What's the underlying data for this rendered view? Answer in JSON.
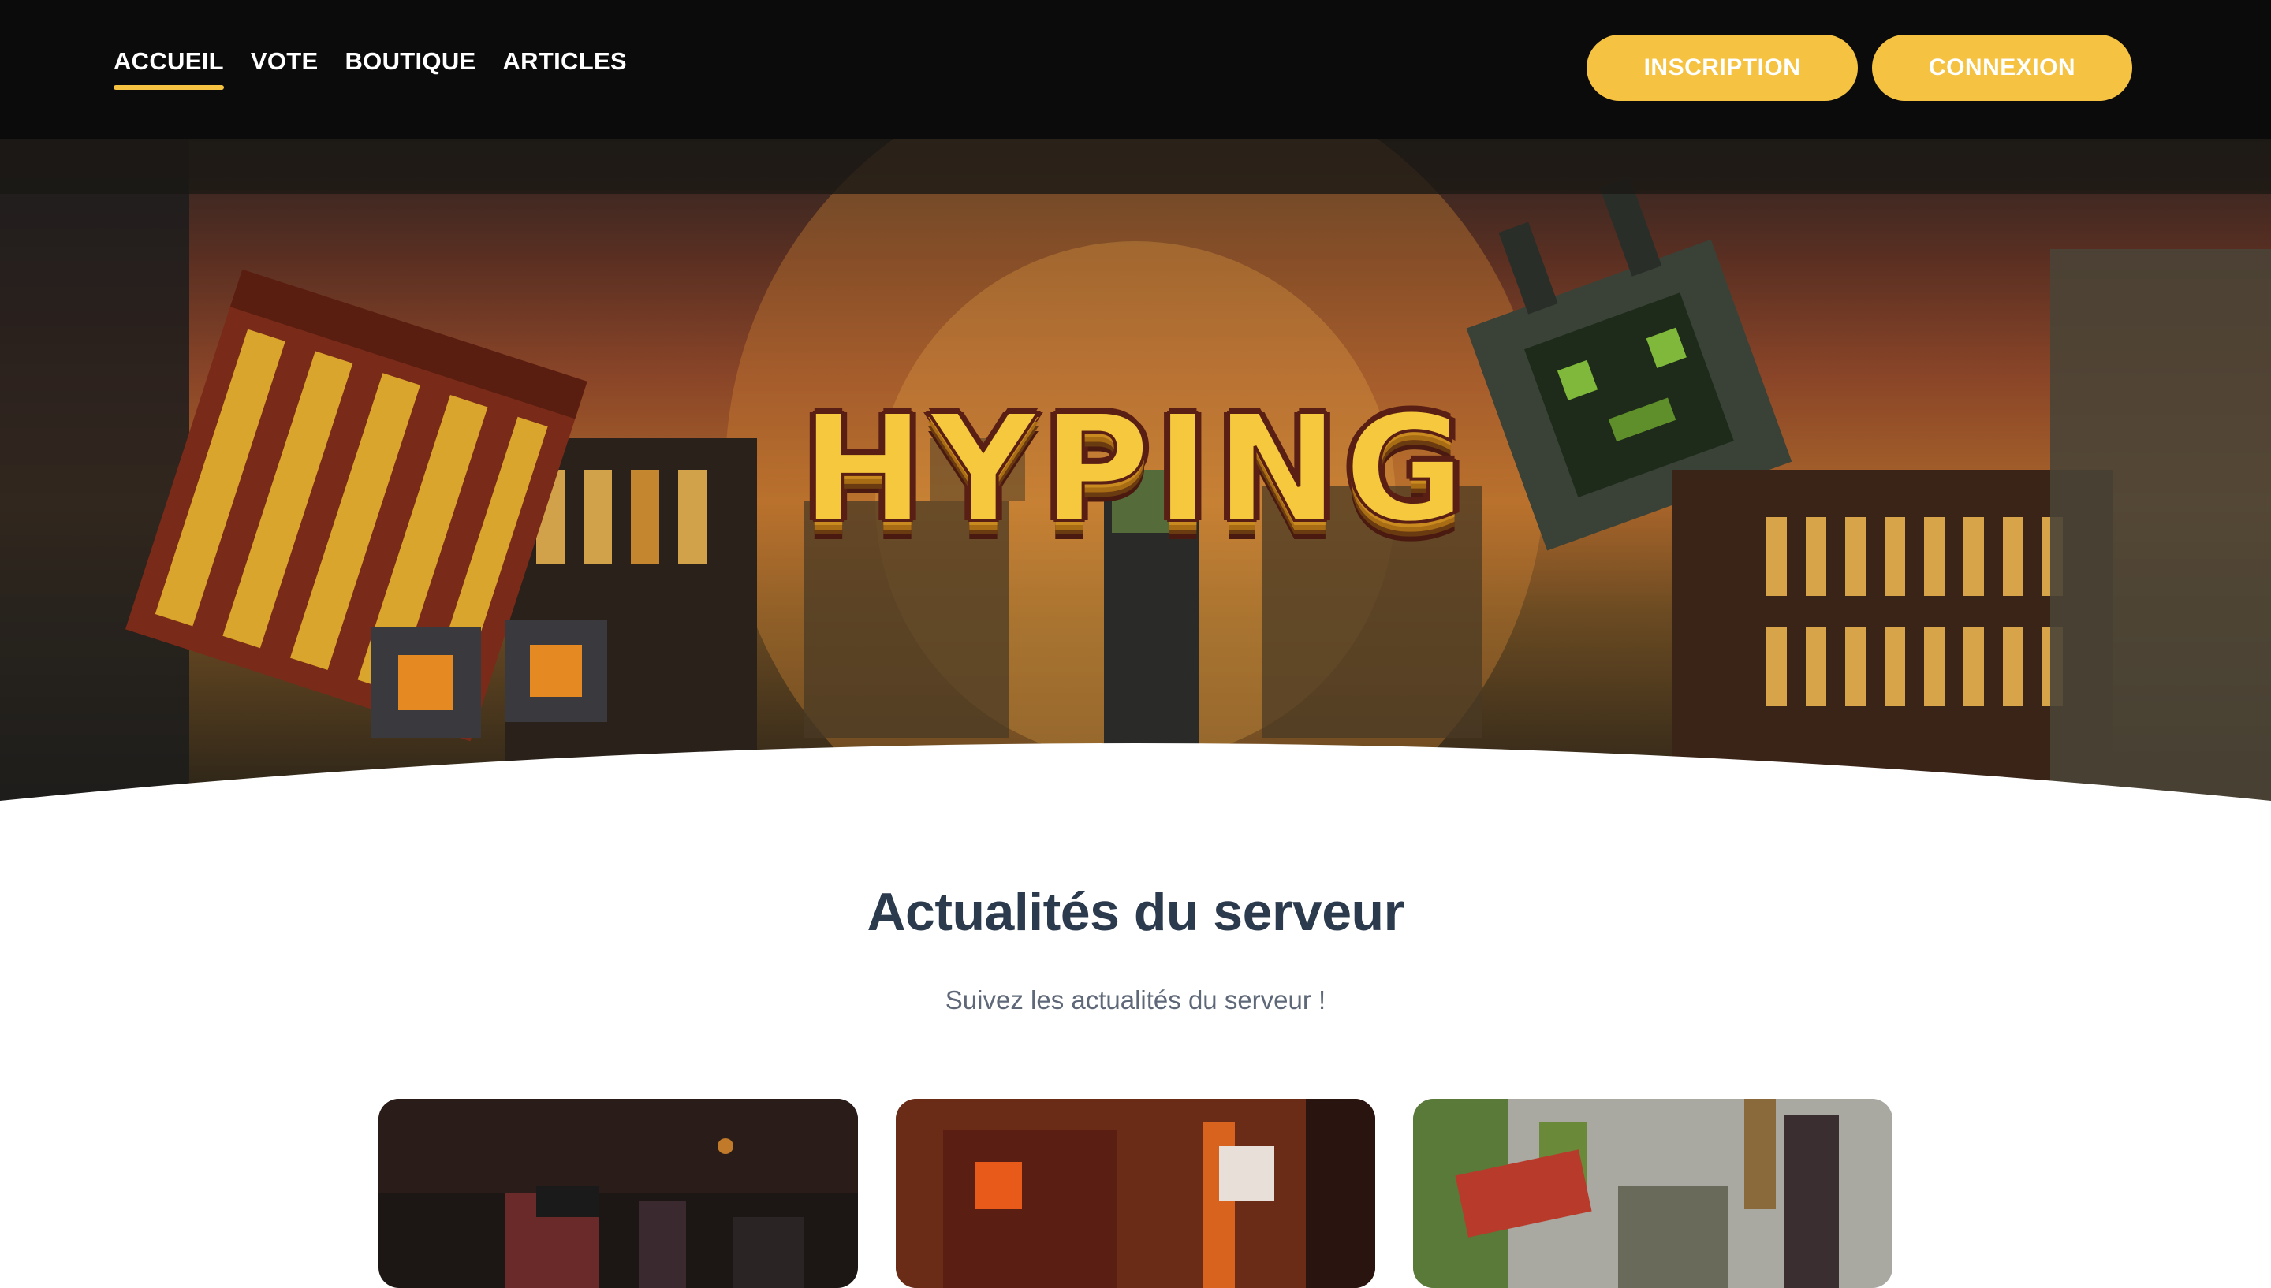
{
  "nav": {
    "links": [
      {
        "label": "ACCUEIL",
        "active": true
      },
      {
        "label": "VOTE",
        "active": false
      },
      {
        "label": "BOUTIQUE",
        "active": false
      },
      {
        "label": "ARTICLES",
        "active": false
      }
    ],
    "signup_label": "INSCRIPTION",
    "login_label": "CONNEXION"
  },
  "hero": {
    "logo_text": "HYPING"
  },
  "news": {
    "title": "Actualités du serveur",
    "subtitle": "Suivez les actualités du serveur !"
  },
  "colors": {
    "accent": "#f5c242",
    "heading": "#2c3a4e",
    "subtext": "#5e6878",
    "navbar_bg": "#0b0b0b"
  }
}
